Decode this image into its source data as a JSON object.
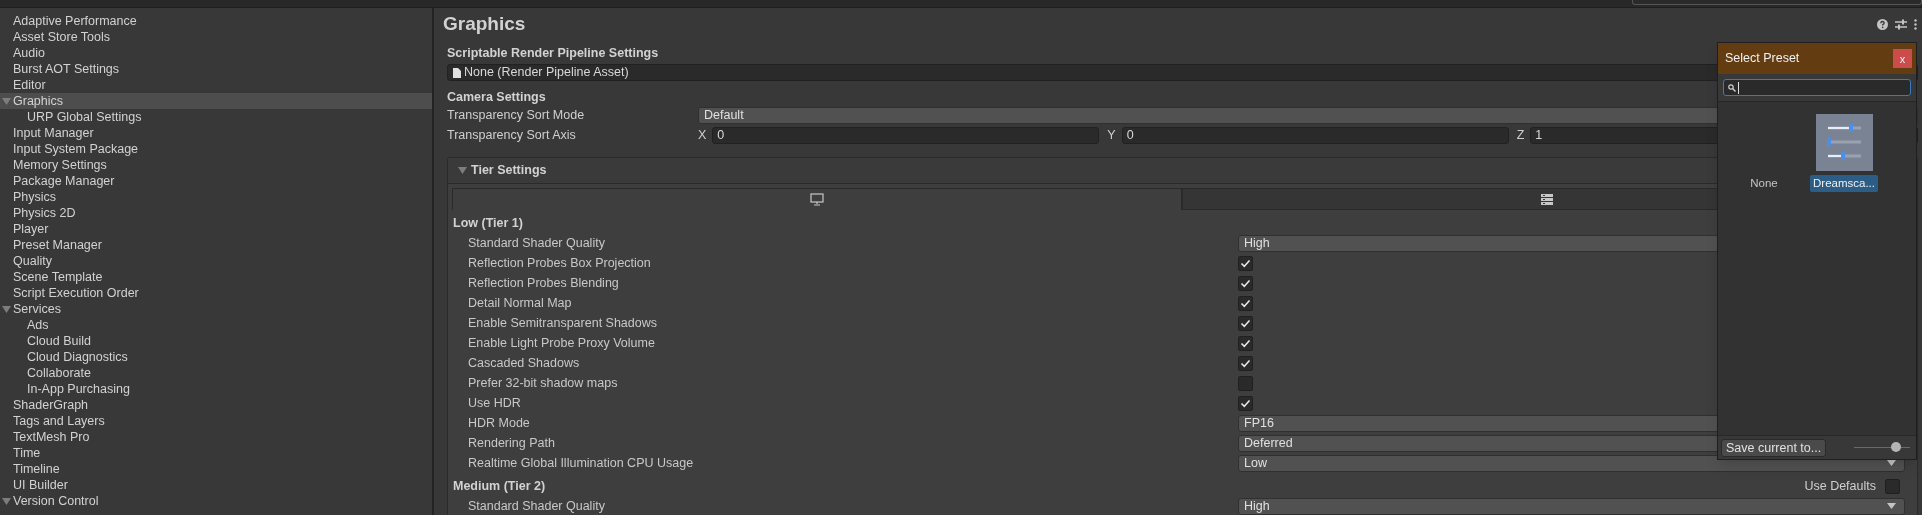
{
  "sidebar": {
    "items": [
      {
        "label": "Adaptive Performance",
        "selected": false
      },
      {
        "label": "Asset Store Tools",
        "selected": false
      },
      {
        "label": "Audio",
        "selected": false
      },
      {
        "label": "Burst AOT Settings",
        "selected": false
      },
      {
        "label": "Editor",
        "selected": false
      },
      {
        "label": "Graphics",
        "selected": true,
        "expanded": true,
        "children": [
          {
            "label": "URP Global Settings",
            "selected": false
          }
        ]
      },
      {
        "label": "Input Manager",
        "selected": false
      },
      {
        "label": "Input System Package",
        "selected": false
      },
      {
        "label": "Memory Settings",
        "selected": false
      },
      {
        "label": "Package Manager",
        "selected": false
      },
      {
        "label": "Physics",
        "selected": false
      },
      {
        "label": "Physics 2D",
        "selected": false
      },
      {
        "label": "Player",
        "selected": false
      },
      {
        "label": "Preset Manager",
        "selected": false
      },
      {
        "label": "Quality",
        "selected": false
      },
      {
        "label": "Scene Template",
        "selected": false
      },
      {
        "label": "Script Execution Order",
        "selected": false
      },
      {
        "label": "Services",
        "selected": false,
        "expanded": true,
        "children": [
          {
            "label": "Ads",
            "selected": false
          },
          {
            "label": "Cloud Build",
            "selected": false
          },
          {
            "label": "Cloud Diagnostics",
            "selected": false
          },
          {
            "label": "Collaborate",
            "selected": false
          },
          {
            "label": "In-App Purchasing",
            "selected": false
          }
        ]
      },
      {
        "label": "ShaderGraph",
        "selected": false
      },
      {
        "label": "Tags and Layers",
        "selected": false
      },
      {
        "label": "TextMesh Pro",
        "selected": false
      },
      {
        "label": "Time",
        "selected": false
      },
      {
        "label": "Timeline",
        "selected": false
      },
      {
        "label": "UI Builder",
        "selected": false
      },
      {
        "label": "Version Control",
        "selected": false,
        "expanded": true
      }
    ]
  },
  "panel": {
    "title": "Graphics",
    "srp": {
      "heading": "Scriptable Render Pipeline Settings",
      "value": "None (Render Pipeline Asset)"
    },
    "camera": {
      "heading": "Camera Settings",
      "sort_mode": {
        "label": "Transparency Sort Mode",
        "value": "Default"
      },
      "sort_axis": {
        "label": "Transparency Sort Axis",
        "fields": [
          {
            "axis": "X",
            "value": "0"
          },
          {
            "axis": "Y",
            "value": "0"
          },
          {
            "axis": "Z",
            "value": "1"
          }
        ]
      }
    },
    "tier_settings": {
      "title": "Tier Settings",
      "expanded": true,
      "tabs": [
        {
          "selected": true
        },
        {
          "selected": false
        }
      ],
      "tiers": [
        {
          "name": "Low (Tier 1)",
          "rows": [
            {
              "kind": "dropdown",
              "label": "Standard Shader Quality",
              "value": "High"
            },
            {
              "kind": "checkbox",
              "label": "Reflection Probes Box Projection",
              "checked": true
            },
            {
              "kind": "checkbox",
              "label": "Reflection Probes Blending",
              "checked": true
            },
            {
              "kind": "checkbox",
              "label": "Detail Normal Map",
              "checked": true
            },
            {
              "kind": "checkbox",
              "label": "Enable Semitransparent Shadows",
              "checked": true
            },
            {
              "kind": "checkbox",
              "label": "Enable Light Probe Proxy Volume",
              "checked": true
            },
            {
              "kind": "checkbox",
              "label": "Cascaded Shadows",
              "checked": true
            },
            {
              "kind": "checkbox",
              "label": "Prefer 32-bit shadow maps",
              "checked": false
            },
            {
              "kind": "checkbox",
              "label": "Use HDR",
              "checked": true
            },
            {
              "kind": "dropdown",
              "label": "HDR Mode",
              "value": "FP16"
            },
            {
              "kind": "dropdown",
              "label": "Rendering Path",
              "value": "Deferred"
            },
            {
              "kind": "dropdown",
              "label": "Realtime Global Illumination CPU Usage",
              "value": "Low"
            }
          ]
        },
        {
          "name": "Medium (Tier 2)",
          "use_defaults": {
            "label": "Use Defaults",
            "checked": false
          },
          "rows": [
            {
              "kind": "dropdown",
              "label": "Standard Shader Quality",
              "value": "High"
            }
          ]
        }
      ]
    }
  },
  "preset_popup": {
    "title": "Select Preset",
    "close": "x",
    "search": {
      "focused": true
    },
    "items": [
      {
        "label": "None",
        "kind": "none",
        "selected": false
      },
      {
        "label": "Dreamsca...",
        "kind": "preset",
        "selected": true
      }
    ],
    "save_button": "Save current to...",
    "zoom": {
      "level": 0.75
    }
  }
}
